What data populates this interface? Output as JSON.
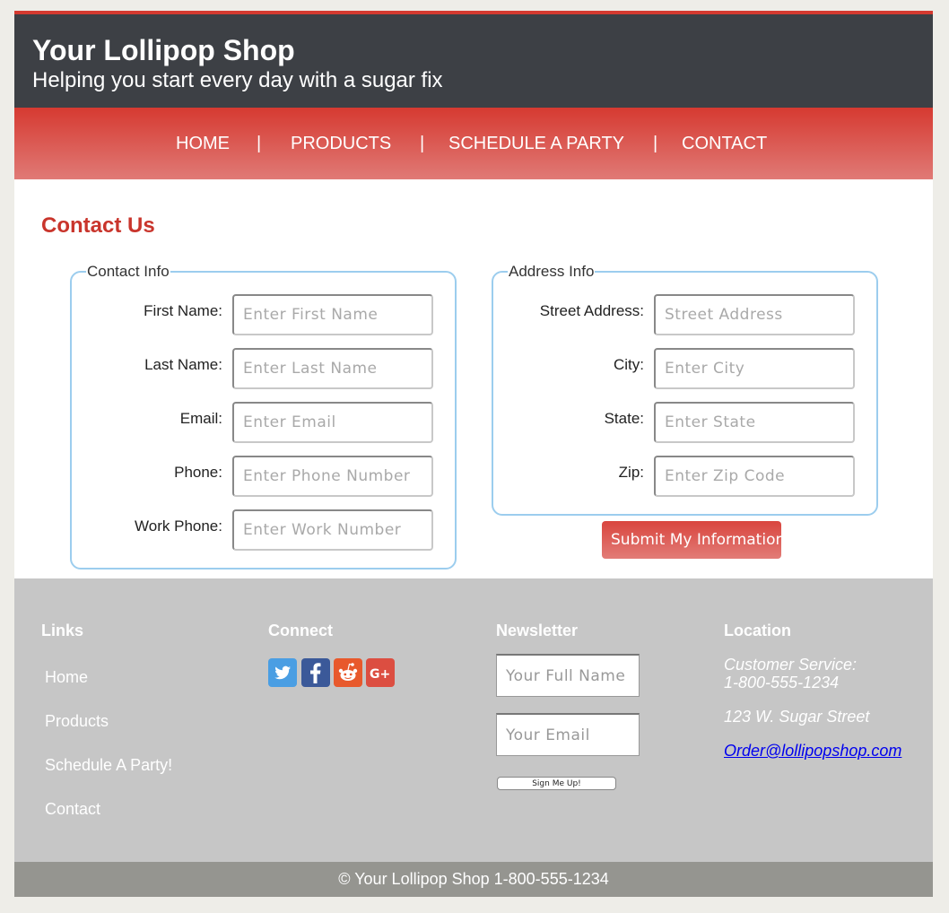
{
  "header": {
    "title": "Your Lollipop Shop",
    "tagline": "Helping you start every day with a sugar fix"
  },
  "nav": {
    "items": [
      "HOME",
      "PRODUCTS",
      "SCHEDULE A PARTY",
      "CONTACT"
    ],
    "separator": "|"
  },
  "main": {
    "title": "Contact Us",
    "contact_info": {
      "legend": "Contact Info",
      "fields": [
        {
          "label": "First Name:",
          "placeholder": "Enter First Name"
        },
        {
          "label": "Last Name:",
          "placeholder": "Enter Last Name"
        },
        {
          "label": "Email:",
          "placeholder": "Enter Email"
        },
        {
          "label": "Phone:",
          "placeholder": "Enter Phone Number"
        },
        {
          "label": "Work Phone:",
          "placeholder": "Enter Work Number"
        }
      ]
    },
    "address_info": {
      "legend": "Address Info",
      "fields": [
        {
          "label": "Street Address:",
          "placeholder": "Street Address"
        },
        {
          "label": "City:",
          "placeholder": "Enter City"
        },
        {
          "label": "State:",
          "placeholder": "Enter State"
        },
        {
          "label": "Zip:",
          "placeholder": "Enter Zip Code"
        }
      ]
    },
    "submit_label": "Submit My Information"
  },
  "footer": {
    "links": {
      "heading": "Links",
      "items": [
        "Home",
        "Products",
        "Schedule A Party!",
        "Contact"
      ]
    },
    "connect": {
      "heading": "Connect",
      "icons": [
        {
          "name": "twitter-icon",
          "color": "#4a9ee3"
        },
        {
          "name": "facebook-icon",
          "color": "#3b5999"
        },
        {
          "name": "reddit-icon",
          "color": "#e8592c"
        },
        {
          "name": "google-plus-icon",
          "color": "#dc4e41"
        }
      ]
    },
    "newsletter": {
      "heading": "Newsletter",
      "name_placeholder": "Your Full Name",
      "email_placeholder": "Your Email",
      "button_label": "Sign Me Up!"
    },
    "location": {
      "heading": "Location",
      "service_label": "Customer Service:",
      "phone": "1-800-555-1234",
      "street": "123 W. Sugar Street",
      "email": "Order@lollipopshop.com"
    }
  },
  "copyright": "© Your Lollipop Shop 1-800-555-1234",
  "colors": {
    "accent_red": "#d43a30",
    "header_dark": "#3d4045",
    "footer_gray": "#c6c6c6",
    "fieldset_border": "#9ccdee"
  }
}
